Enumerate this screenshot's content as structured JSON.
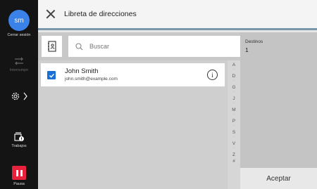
{
  "header": {
    "title": "Libreta de direcciones"
  },
  "sidebar": {
    "avatar_initials": "sm",
    "logout_label": "Cerrar sesión",
    "interrupt_label": "Interrumpir",
    "jobs_label": "Trabajos",
    "pause_label": "Pausa"
  },
  "search": {
    "placeholder": "Buscar"
  },
  "contacts": [
    {
      "name": "John Smith",
      "email": "john.smith@example.com",
      "checked": true
    }
  ],
  "alphabet_index": [
    "A",
    "D",
    "G",
    "J",
    "M",
    "P",
    "S",
    "V",
    "Z",
    "#"
  ],
  "destinations": {
    "label": "Destinos",
    "count": "1"
  },
  "accept_label": "Aceptar",
  "colors": {
    "accent": "#1a6fd4",
    "pause": "#e8223d",
    "avatar": "#3b82e8",
    "header_rule": "#7a98aa"
  },
  "icons": [
    "close-icon",
    "address-book-icon",
    "search-icon",
    "info-icon",
    "settings-icon",
    "jobs-icon",
    "pause-icon",
    "interrupt-icon",
    "check-icon"
  ]
}
